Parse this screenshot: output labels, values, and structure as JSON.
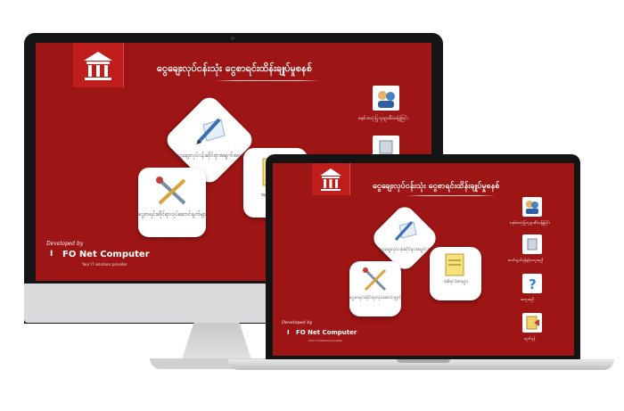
{
  "app": {
    "title": "ငွေချေးလုပ်ငန်းသုံး ငွေစာရင်းထိန်းချုပ်မှုစနစ်"
  },
  "cards": [
    {
      "caption": "ငွေချေးလုပ်ငန်းဆိုင်ရာအချက်အလက်များ",
      "icon": "pencil-paper-icon"
    },
    {
      "caption": "ငွေစာရင်းဆိုင်ရာလုပ်ဆောင်ချက်များ",
      "icon": "tools-icon"
    },
    {
      "caption": "အစီရင်ခံစာများ",
      "icon": "report-icon"
    }
  ],
  "sidebar": {
    "items": [
      {
        "label": "စနစ်အသုံးပြုသူများစီမံခန့်ခွဲခြင်း",
        "icon": "users-icon"
      },
      {
        "label": "ဆက်သွယ်ရန်နှင့်အကူအညီ",
        "icon": "server-icon"
      },
      {
        "label": "အကူအညီ",
        "icon": "help-icon"
      },
      {
        "label": "ထွက်ရန်",
        "icon": "exit-icon"
      }
    ]
  },
  "footer": {
    "developed_by": "Developed by",
    "logo_text": "I",
    "company": "FO Net Computer",
    "tagline": "Your IT solutions provider"
  },
  "colors": {
    "background": "#9e1515",
    "header_tile": "#c01d1d",
    "text": "#ffffff"
  }
}
